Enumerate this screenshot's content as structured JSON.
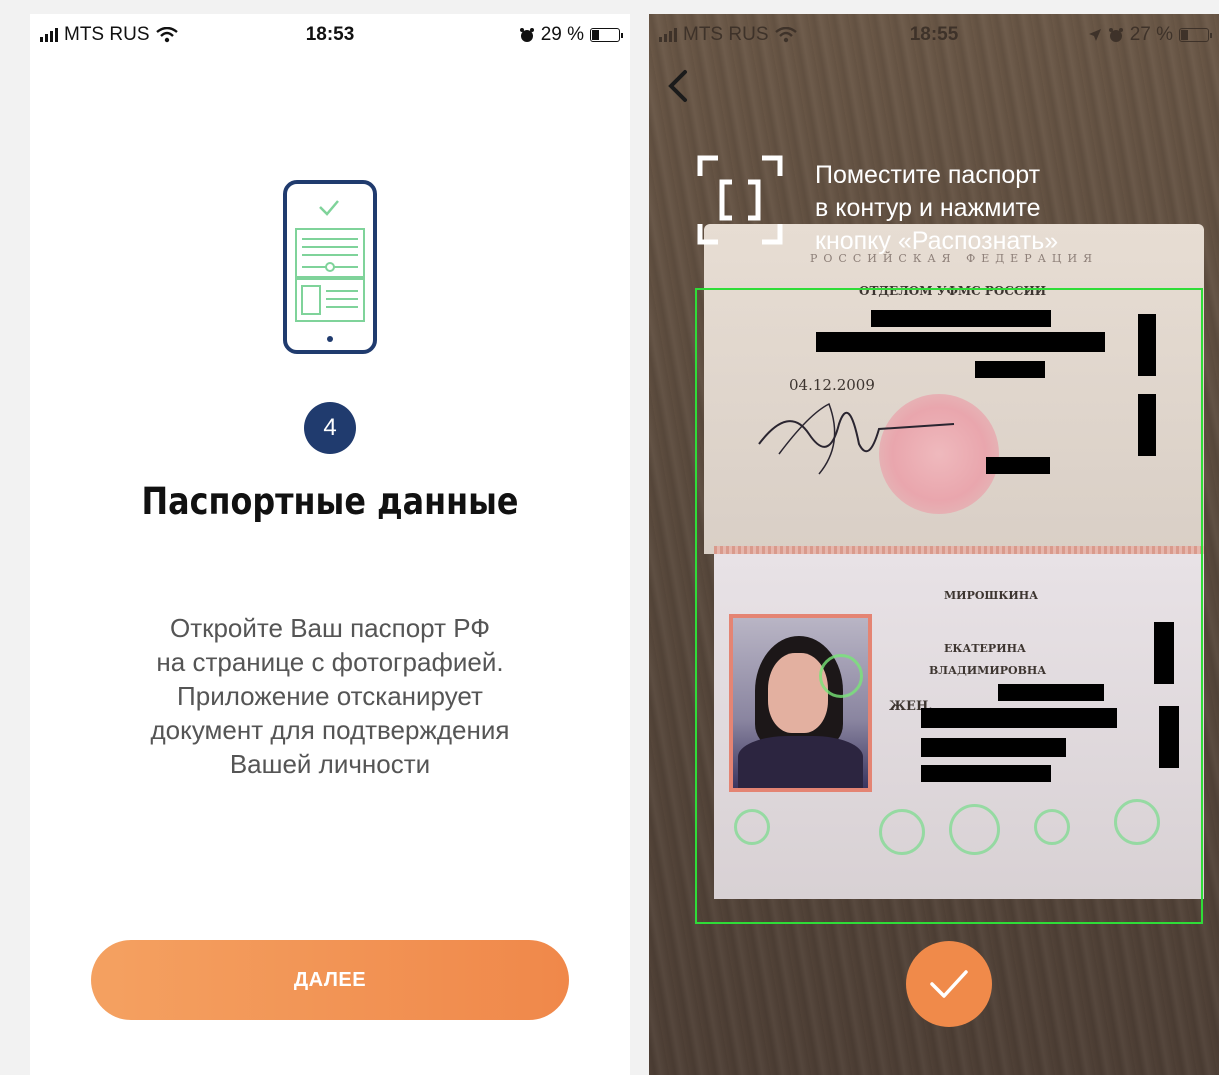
{
  "left_screen": {
    "status_bar": {
      "carrier": "MTS RUS",
      "time": "18:53",
      "battery": "29 %",
      "battery_level": 0.29
    },
    "step_number": "4",
    "title": "Паспортные данные",
    "description_lines": [
      "Откройте Ваш паспорт РФ",
      "на странице с фотографией.",
      "Приложение отсканирует",
      "документ для подтверждения",
      "Вашей личности"
    ],
    "next_button_label": "ДАЛЕЕ",
    "colors": {
      "accent": "#f0884a",
      "badge": "#203b6e",
      "illustration_outline": "#203b6e",
      "illustration_lines": "#7fd39a"
    },
    "icons": [
      "phone-document-illustration",
      "check-icon",
      "signal-icon",
      "wifi-icon",
      "alarm-icon",
      "battery-icon"
    ]
  },
  "right_screen": {
    "status_bar": {
      "carrier": "MTS RUS",
      "time": "18:55",
      "battery": "27 %",
      "battery_level": 0.27
    },
    "hint_lines": [
      "Поместите паспорт",
      "в контур и нажмите",
      "кнопку «Распознать»"
    ],
    "passport": {
      "header": "РОССИЙСКАЯ ФЕДЕРАЦИЯ",
      "issued_by": "ОТДЕЛОМ УФМС РОССИИ",
      "issue_date": "04.12.2009",
      "surname": "МИРОШКИНА",
      "given_name": "ЕКАТЕРИНА",
      "patronymic": "ВЛАДИМИРОВНА",
      "sex": "ЖЕН."
    },
    "colors": {
      "scan_frame": "#2fdc38",
      "confirm_button": "#f08a4a"
    },
    "icons": [
      "back-arrow-icon",
      "scan-frame-icon",
      "check-icon",
      "location-icon",
      "alarm-icon",
      "battery-icon"
    ]
  }
}
